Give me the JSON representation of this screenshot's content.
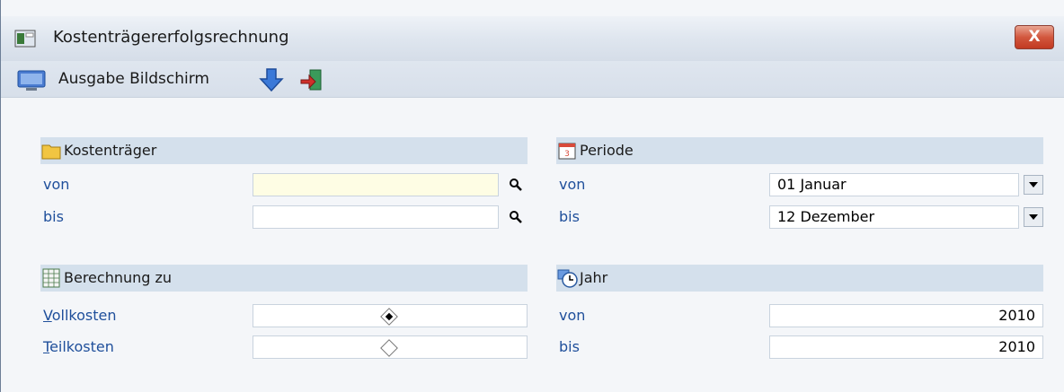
{
  "window": {
    "title": "Kostenträgererfolgsrechnung",
    "close_label": "X"
  },
  "toolbar": {
    "output_label": "Ausgabe Bildschirm"
  },
  "kostentraeger": {
    "header": "Kostenträger",
    "von_label": "von",
    "bis_label": "bis",
    "von_value": "",
    "bis_value": ""
  },
  "berechnung": {
    "header": "Berechnung zu",
    "vollkosten_prefix": "V",
    "vollkosten_rest": "ollkosten",
    "teilkosten_prefix": "T",
    "teilkosten_rest": "eilkosten",
    "selected": "Vollkosten"
  },
  "periode": {
    "header": "Periode",
    "von_label": "von",
    "bis_label": "bis",
    "von_value": "01 Januar",
    "bis_value": "12 Dezember"
  },
  "jahr": {
    "header": "Jahr",
    "von_label": "von",
    "bis_label": "bis",
    "von_value": "2010",
    "bis_value": "2010"
  },
  "icons": {
    "title": "window-app-icon",
    "monitor": "monitor-icon",
    "arrow": "arrow-down-icon",
    "exit": "exit-door-icon",
    "search": "magnifier-icon",
    "folder": "folder-icon",
    "calendar": "calendar-icon",
    "table": "table-icon",
    "clock": "clock-icon"
  }
}
